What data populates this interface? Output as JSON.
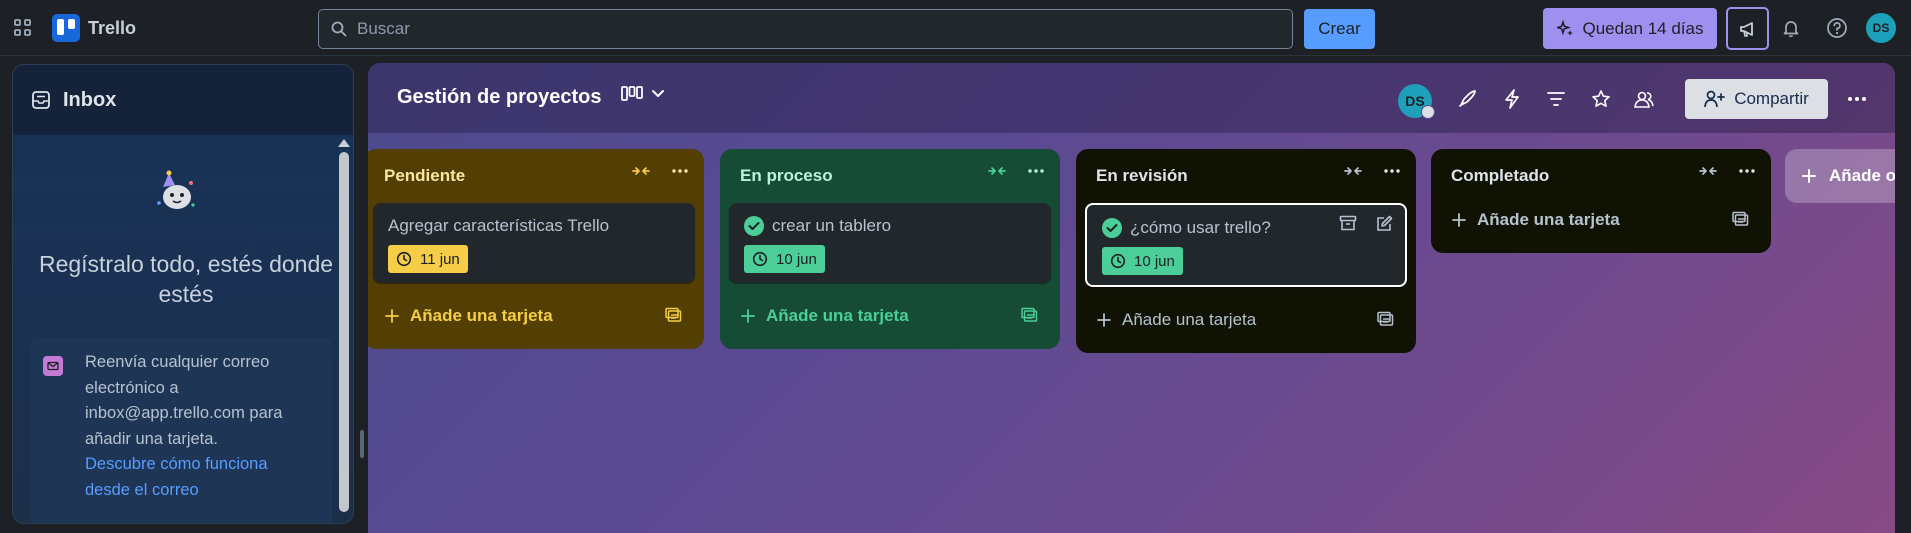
{
  "app": {
    "name": "Trello"
  },
  "topbar": {
    "search_placeholder": "Buscar",
    "create_label": "Crear",
    "trial_label": "Quedan 14 días",
    "avatar_initials": "DS"
  },
  "inbox": {
    "title": "Inbox",
    "heading": "Regístralo todo, estés donde estés",
    "card_text": "Reenvía cualquier correo electrónico a inbox@app.trello.com para añadir una tarjeta.",
    "card_link": "Descubre cómo funciona desde el correo"
  },
  "board": {
    "title": "Gestión de proyectos",
    "member_initials": "DS",
    "share_label": "Compartir",
    "add_list_label": "Añade otra lista",
    "lists": [
      {
        "title": "Pendiente",
        "bg": "#533f04",
        "title_color": "#f8e6a0",
        "accent": "#f5cd47",
        "cards": [
          {
            "title": "Agregar características Trello",
            "due": "11 jun",
            "completed": false
          }
        ],
        "add_label": "Añade una tarjeta"
      },
      {
        "title": "En proceso",
        "bg": "#164b35",
        "title_color": "#baf3db",
        "accent": "#4bce97",
        "cards": [
          {
            "title": "crear un tablero",
            "due": "10 jun",
            "completed": true
          }
        ],
        "add_label": "Añade una tarjeta"
      },
      {
        "title": "En revisión",
        "bg": "#101204",
        "title_color": "#dee4ea",
        "accent": "#b6c2cf",
        "cards": [
          {
            "title": "¿cómo usar trello?",
            "due": "10 jun",
            "completed": true
          }
        ],
        "add_label": "Añade una tarjeta"
      },
      {
        "title": "Completado",
        "bg": "#101204",
        "title_color": "#dee4ea",
        "accent": "#b6c2cf",
        "cards": [],
        "add_label": "Añade una tarjeta"
      }
    ]
  },
  "colors": {
    "topbar_bg": "#1d2125",
    "create_button": "#579dff",
    "trial_button": "#9f8fef",
    "avatar": "#1e9fba"
  }
}
